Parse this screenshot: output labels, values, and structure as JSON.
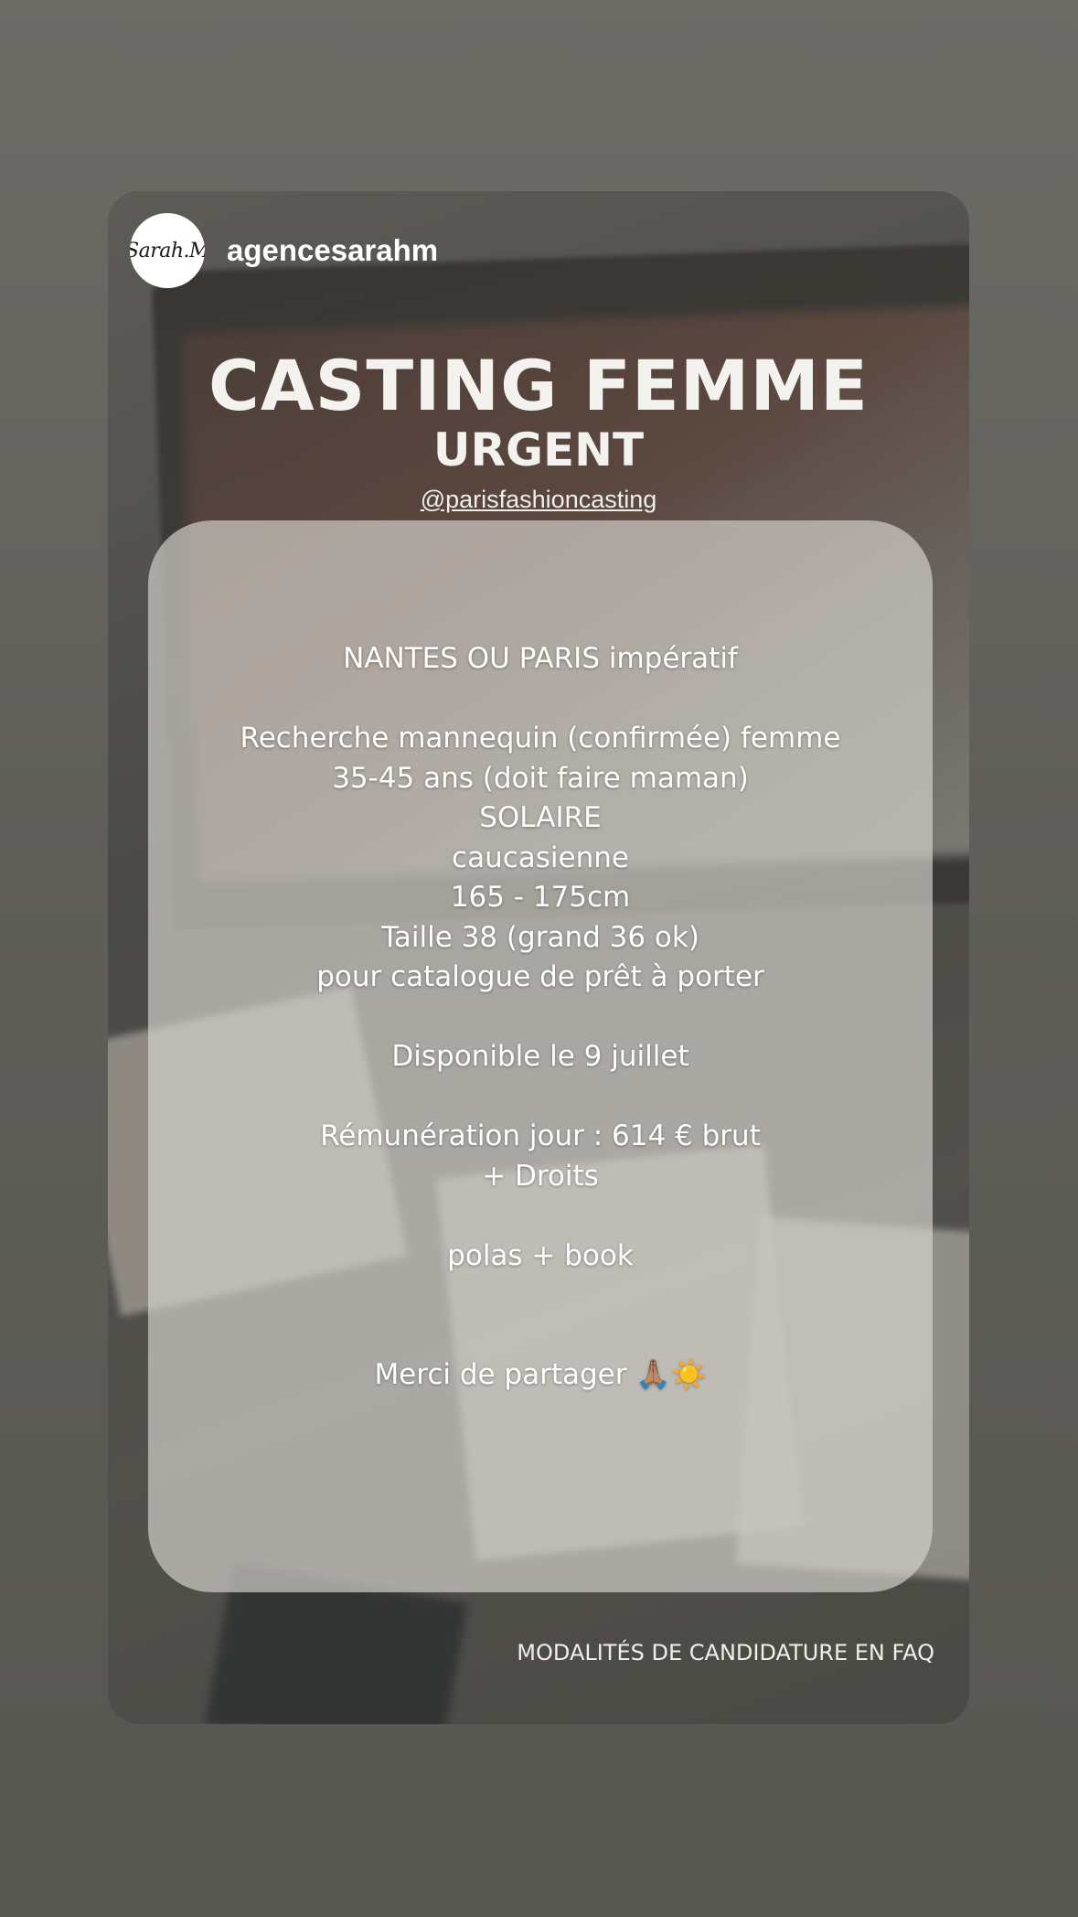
{
  "story": {
    "avatar_text": "Sarah.M",
    "username": "agencesarahm",
    "title": "CASTING FEMME",
    "subtitle": "URGENT",
    "mention": "@parisfashioncasting",
    "lines": [
      "NANTES OU PARIS impératif",
      "",
      "Recherche mannequin (confirmée) femme",
      "35-45 ans (doit faire maman)",
      "SOLAIRE",
      "caucasienne",
      "165 - 175cm",
      "Taille 38 (grand 36 ok)",
      "pour catalogue de prêt à porter",
      "",
      "Disponible le 9 juillet",
      "",
      "Rémunération jour : 614 € brut",
      "+ Droits",
      "",
      "polas + book",
      "",
      "",
      "Merci de partager 🙏🏽☀️"
    ],
    "footer": "MODALITÉS DE CANDIDATURE EN FAQ"
  }
}
